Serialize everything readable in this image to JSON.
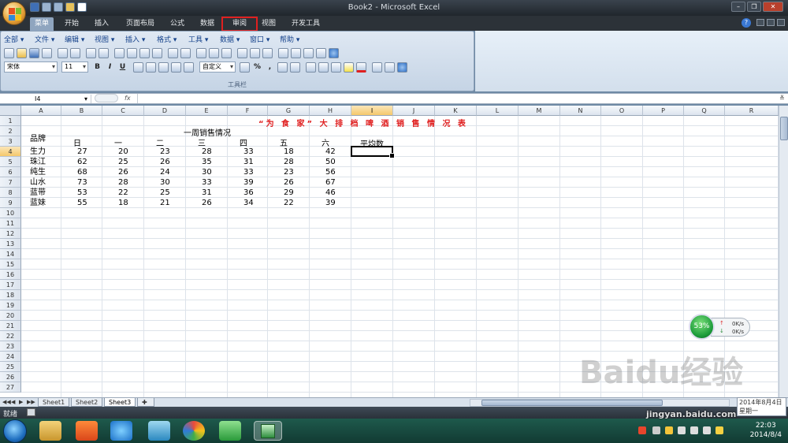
{
  "window": {
    "title": "Book2 - Microsoft Excel"
  },
  "ribbon_tabs": [
    "菜单",
    "开始",
    "插入",
    "页面布局",
    "公式",
    "数据",
    "审阅",
    "视图",
    "开发工具"
  ],
  "active_tab": "菜单",
  "highlighted_tab": "审阅",
  "classic_menu": [
    "全部",
    "文件",
    "编辑",
    "视图",
    "插入",
    "格式",
    "工具",
    "数据",
    "窗口",
    "帮助"
  ],
  "font_name": "宋体",
  "font_size": "11",
  "custom_format": "自定义",
  "format_buttons": {
    "bold": "B",
    "italic": "I",
    "underline": "U",
    "percent": "%",
    "comma": ","
  },
  "toolbar_caption": "工具栏",
  "name_box": "I4",
  "formula_label": "fx",
  "columns": [
    "A",
    "B",
    "C",
    "D",
    "E",
    "F",
    "G",
    "H",
    "I",
    "J",
    "K",
    "L",
    "M",
    "N",
    "O",
    "P",
    "Q",
    "R"
  ],
  "rows": [
    "1",
    "2",
    "3",
    "4",
    "5",
    "6",
    "7",
    "8",
    "9",
    "10",
    "11",
    "12",
    "13",
    "14",
    "15",
    "16",
    "17",
    "18",
    "19",
    "20",
    "21",
    "22",
    "23",
    "24",
    "25",
    "26",
    "27"
  ],
  "selected_column": "I",
  "selected_row": "4",
  "sheet": {
    "title": "“为 食 家” 大 排 档 啤 酒 销 售 情 况 表",
    "week_header": "一周销售情况",
    "brand_header": "品牌",
    "day_headers": [
      "日",
      "一",
      "二",
      "三",
      "四",
      "五",
      "六"
    ],
    "avg_header": "平均数",
    "title_color": "#e02020",
    "data": [
      {
        "brand": "生力",
        "values": [
          "27",
          "20",
          "23",
          "28",
          "33",
          "18",
          "42"
        ]
      },
      {
        "brand": "珠江",
        "values": [
          "62",
          "25",
          "26",
          "35",
          "31",
          "28",
          "50"
        ]
      },
      {
        "brand": "纯生",
        "values": [
          "68",
          "26",
          "24",
          "30",
          "33",
          "23",
          "56"
        ]
      },
      {
        "brand": "山水",
        "values": [
          "73",
          "28",
          "30",
          "33",
          "39",
          "26",
          "67"
        ]
      },
      {
        "brand": "蓝带",
        "values": [
          "53",
          "22",
          "25",
          "31",
          "36",
          "29",
          "46"
        ]
      },
      {
        "brand": "蓝妹",
        "values": [
          "55",
          "18",
          "21",
          "26",
          "34",
          "22",
          "39"
        ]
      }
    ]
  },
  "sheet_tabs": [
    "Sheet1",
    "Sheet2",
    "Sheet3"
  ],
  "active_sheet": "Sheet3",
  "status": {
    "ready": "就绪"
  },
  "net_widget": {
    "percent": "53%",
    "up": "0K/s",
    "down": "0K/s"
  },
  "date_bubble": {
    "date": "2014年8月4日",
    "weekday": "星期一"
  },
  "clock": {
    "time": "22:03",
    "date": "2014/8/4"
  },
  "watermark": {
    "logo": "Baidu经验",
    "url": "jingyan.baidu.com"
  }
}
